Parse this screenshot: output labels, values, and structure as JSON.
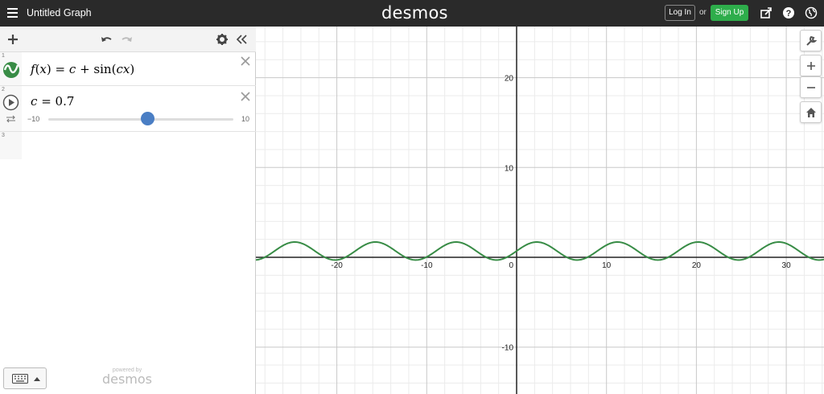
{
  "topbar": {
    "graph_title": "Untitled Graph",
    "logo": "desmos",
    "login_label": "Log In",
    "or_label": "or",
    "signup_label": "Sign Up",
    "signup_color": "#2ead4b",
    "icons": [
      "menu-icon",
      "share-icon",
      "help-icon",
      "globe-icon"
    ]
  },
  "panel": {
    "header_icons": [
      "add-icon",
      "undo-icon",
      "redo-icon",
      "settings-icon",
      "collapse-icon"
    ],
    "expressions": [
      {
        "num": "1",
        "latex_lhs": "f",
        "latex_var": "x",
        "latex_rhs_c": "c",
        "latex_plus": "+",
        "latex_fn": "sin",
        "latex_arg": "cx",
        "color": "#388c46",
        "icon": "wave-icon"
      },
      {
        "num": "2",
        "variable": "c",
        "equals": "=",
        "value": "0.7",
        "slider_min": "−10",
        "slider_max": "10",
        "slider_fraction": 0.535,
        "thumb_color": "#4a7ec4",
        "icons": [
          "play-icon",
          "loop-icon"
        ]
      },
      {
        "num": "3"
      }
    ],
    "keyboard_icon": "keyboard-icon",
    "powered_by": "powered by",
    "powered_logo": "desmos"
  },
  "graph": {
    "x_ticks": [
      "-20",
      "-10",
      "0",
      "10",
      "20",
      "30"
    ],
    "y_ticks": [
      "20",
      "10",
      "-10"
    ],
    "x_range": [
      -29,
      34
    ],
    "y_range": [
      -15,
      26
    ],
    "c": 0.7,
    "curve_color": "#388c46"
  },
  "controls": {
    "icons": [
      "wrench-icon",
      "zoom-in-icon",
      "zoom-out-icon",
      "home-icon"
    ]
  }
}
